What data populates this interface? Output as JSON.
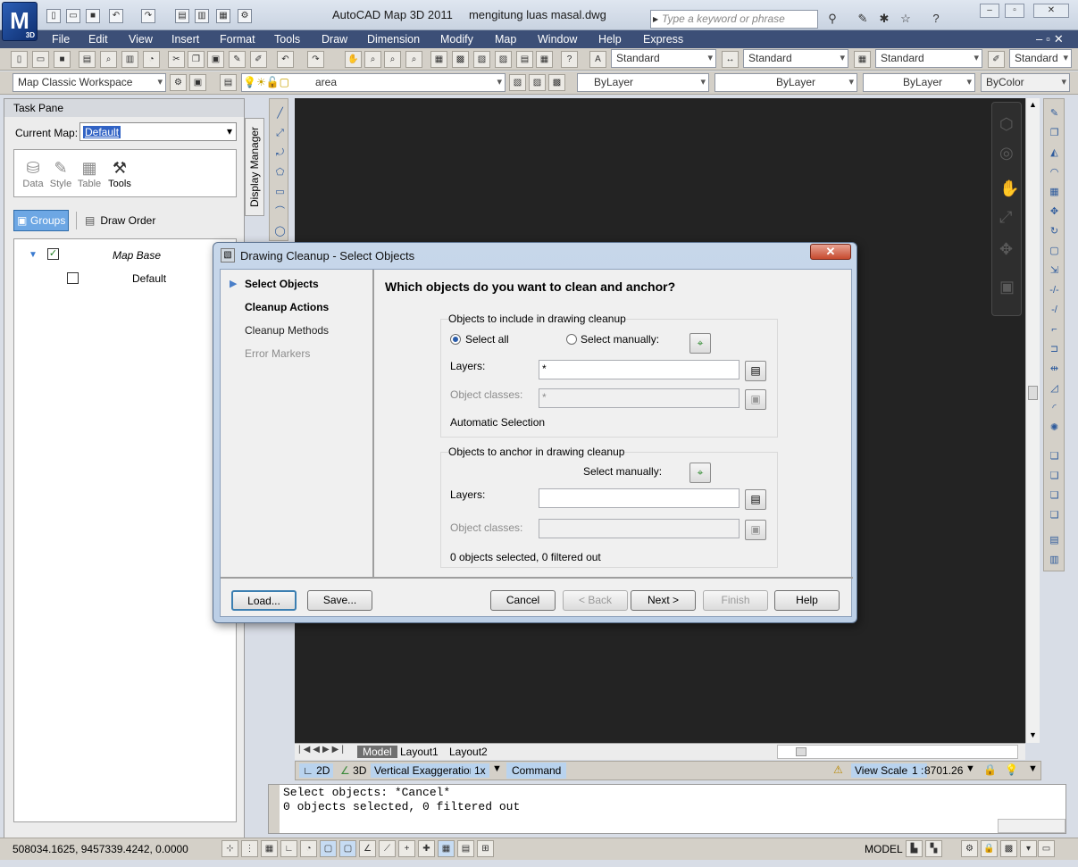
{
  "window": {
    "title": "AutoCAD Map 3D 2011     mengitung luas masal.dwg",
    "search_placeholder": "Type a keyword or phrase",
    "logo_text": "M",
    "logo_sub": "3D"
  },
  "menu": [
    "File",
    "Edit",
    "View",
    "Insert",
    "Format",
    "Tools",
    "Draw",
    "Dimension",
    "Modify",
    "Map",
    "Window",
    "Help",
    "Express"
  ],
  "toolbar": {
    "text_style": "Standard",
    "dim_style": "Standard",
    "table_style": "Standard",
    "mleader_style": "Standard",
    "workspace": "Map Classic Workspace",
    "layer": "area",
    "color": "ByLayer",
    "linetype": "ByLayer",
    "lineweight": "ByLayer",
    "plotstyle": "ByColor"
  },
  "taskpane": {
    "header": "Task Pane",
    "current_map_label": "Current Map:",
    "current_map": "Default",
    "tools": [
      "Data",
      "Style",
      "Table",
      "Tools"
    ],
    "groups_label": "Groups",
    "draw_order_label": "Draw Order",
    "tree": {
      "map_base": "Map Base",
      "default_layer": "Default"
    },
    "display_manager_tab": "Display Manager"
  },
  "layout_tabs": [
    "Model",
    "Layout1",
    "Layout2"
  ],
  "status": {
    "mode_2d": "2D",
    "mode_3d": "3D",
    "vert_exag_label": "Vertical Exaggeration:",
    "vert_exag_value": "1x",
    "command_label": "Command",
    "view_scale_label": "View Scale",
    "view_scale_prefix": "1 :",
    "view_scale_value": "8701.26",
    "model_label": "MODEL",
    "coords": "508034.1625, 9457339.4242, 0.0000"
  },
  "command_window": {
    "lines": [
      "Select objects: *Cancel*",
      "0 objects selected, 0 filtered out"
    ]
  },
  "dialog": {
    "title": "Drawing Cleanup - Select Objects",
    "steps": [
      "Select Objects",
      "Cleanup Actions",
      "Cleanup Methods",
      "Error Markers"
    ],
    "heading": "Which objects do you want to clean and anchor?",
    "include": {
      "label": "Objects to include in drawing cleanup",
      "select_all": "Select all",
      "select_manually": "Select manually:",
      "layers_label": "Layers:",
      "layers_value": "*",
      "classes_label": "Object classes:",
      "classes_value": "*",
      "auto_selection": "Automatic Selection"
    },
    "anchor": {
      "label": "Objects to anchor in drawing cleanup",
      "select_manually": "Select manually:",
      "layers_label": "Layers:",
      "layers_value": "",
      "classes_label": "Object classes:",
      "classes_value": "",
      "summary": "0 objects selected, 0 filtered out"
    },
    "buttons": {
      "load": "Load...",
      "save": "Save...",
      "cancel": "Cancel",
      "back": "< Back",
      "next": "Next >",
      "finish": "Finish",
      "help": "Help"
    },
    "close": "✕"
  }
}
